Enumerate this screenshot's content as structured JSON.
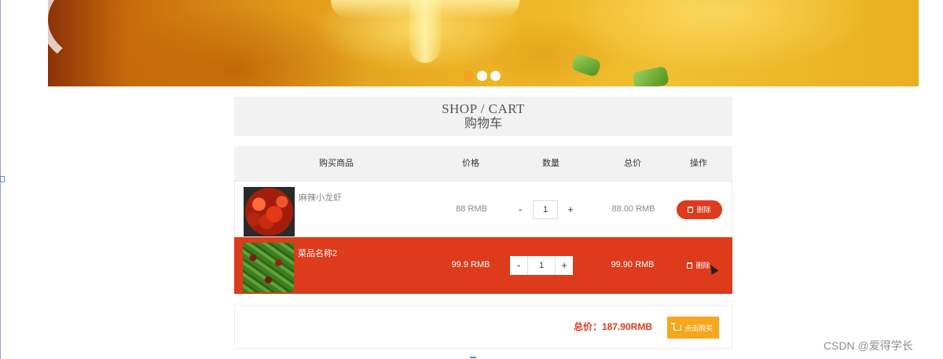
{
  "banner": {
    "slide_indicators": [
      {
        "active": true
      },
      {
        "active": false
      },
      {
        "active": false
      }
    ],
    "colors": {
      "active_dot": "#f5a020",
      "inactive_dot": "#ffffff"
    }
  },
  "page_title": {
    "en": "SHOP / CART",
    "zh": "购物车"
  },
  "table": {
    "headers": {
      "product": "购买商品",
      "price": "价格",
      "quantity": "数量",
      "total": "总价",
      "action": "操作"
    },
    "rows": [
      {
        "name": "麻辣小龙虾",
        "image": "crayfish-dish",
        "price": "88 RMB",
        "qty_minus": "-",
        "quantity": "1",
        "qty_plus": "+",
        "total": "88.00 RMB",
        "delete_label": "删除",
        "highlighted": false
      },
      {
        "name": "菜品名称2",
        "image": "green-beans-dish",
        "price": "99.9 RMB",
        "qty_minus": "-",
        "quantity": "1",
        "qty_plus": "+",
        "total": "99.90 RMB",
        "delete_label": "删除",
        "highlighted": true
      }
    ]
  },
  "footer": {
    "total_text": "总价：187.90RMB",
    "buy_label": "点击购买"
  },
  "watermark": "CSDN @爱得学长",
  "colors": {
    "accent_red": "#de3a1c",
    "buy_orange": "#f5a81c",
    "header_gray": "#f2f2f2"
  }
}
